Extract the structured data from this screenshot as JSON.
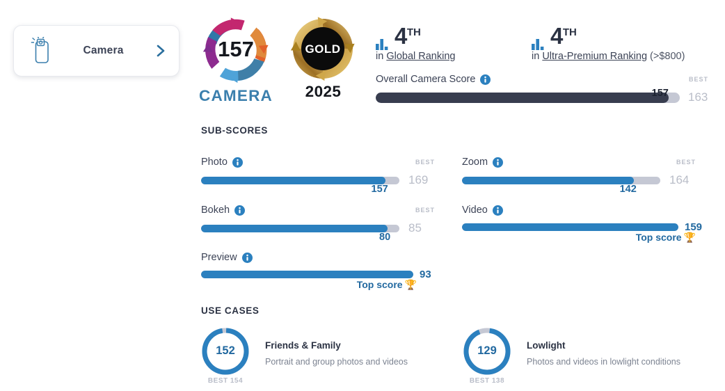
{
  "card": {
    "label": "Camera",
    "icon": "phone-camera-icon",
    "chevron": "chevron-right-icon"
  },
  "badges": {
    "camera": {
      "score": "157",
      "word": "CAMERA"
    },
    "award": {
      "tier": "GOLD",
      "year": "2025"
    }
  },
  "rankings": [
    {
      "place": "4",
      "ordinal": "TH",
      "prefix": "in",
      "link": "Global Ranking",
      "suffix": ""
    },
    {
      "place": "4",
      "ordinal": "TH",
      "prefix": "in",
      "link": "Ultra-Premium Ranking",
      "suffix": "(>$800)"
    }
  ],
  "overall": {
    "label": "Overall Camera Score",
    "info": "info-icon",
    "best_caption": "BEST",
    "best": "163",
    "value": "157",
    "fill_pct": 96.3,
    "fill_color": "#383d4f",
    "track_color": "#c5c8d4"
  },
  "sections": {
    "subscores": "SUB-SCORES",
    "usecases": "USE CASES"
  },
  "subscores": [
    {
      "name": "Photo",
      "value": "157",
      "best": "169",
      "best_caption": "BEST",
      "fill_pct": 92.9,
      "top_score": false,
      "top_label": "",
      "trophy": ""
    },
    {
      "name": "Zoom",
      "value": "142",
      "best": "164",
      "best_caption": "BEST",
      "fill_pct": 86.6,
      "top_score": false,
      "top_label": "",
      "trophy": ""
    },
    {
      "name": "Bokeh",
      "value": "80",
      "best": "85",
      "best_caption": "BEST",
      "fill_pct": 94.1,
      "top_score": false,
      "top_label": "",
      "trophy": ""
    },
    {
      "name": "Video",
      "value": "159",
      "best": "",
      "best_caption": "",
      "fill_pct": 100,
      "top_score": true,
      "top_label": "Top score",
      "trophy": "🏆"
    },
    {
      "name": "Preview",
      "value": "93",
      "best": "",
      "best_caption": "",
      "fill_pct": 100,
      "top_score": true,
      "top_label": "Top score",
      "trophy": "🏆"
    }
  ],
  "usecases": [
    {
      "value": "152",
      "best": "BEST 154",
      "title": "Friends & Family",
      "desc": "Portrait and group photos and videos",
      "fill_pct": 97
    },
    {
      "value": "129",
      "best": "BEST 138",
      "title": "Lowlight",
      "desc": "Photos and videos in lowlight conditions",
      "fill_pct": 92
    }
  ],
  "colors": {
    "accent_blue": "#2b80bf",
    "link_blue": "#2269a0",
    "dark": "#383d4f",
    "muted": "#b9bdc8"
  }
}
